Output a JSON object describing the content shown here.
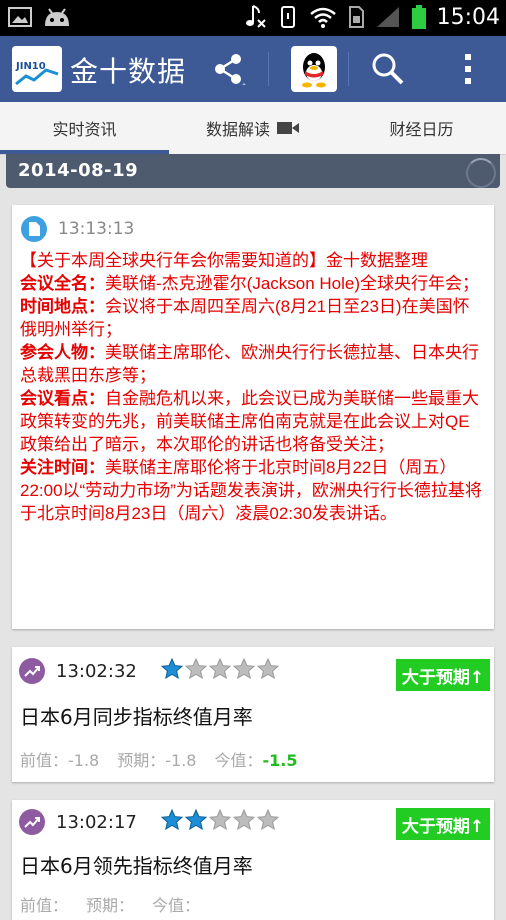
{
  "status_bar": {
    "time": "15:04",
    "icons": [
      "image-icon",
      "android-icon",
      "music-muted-icon",
      "vibrate-icon",
      "wifi-icon",
      "sim-icon",
      "signal-icon",
      "battery-icon"
    ]
  },
  "app": {
    "logo_text": "JIN10",
    "title": "金十数据",
    "actions": [
      "share-icon",
      "qq-icon",
      "search-icon",
      "overflow-menu-icon"
    ]
  },
  "tabs": [
    {
      "label": "实时资讯",
      "active": true
    },
    {
      "label": "数据解读",
      "icon": "video-camera-icon"
    },
    {
      "label": "财经日历"
    }
  ],
  "date_header": "2014-08-19",
  "news": {
    "time": "13:13:13",
    "headline": "【关于本周全球央行年会你需要知道的】金十数据整理",
    "sections": [
      {
        "label": "会议全名：",
        "text": "美联储-杰克逊霍尔(Jackson Hole)全球央行年会；"
      },
      {
        "label": "时间地点：",
        "text": "会议将于本周四至周六(8月21日至23日)在美国怀俄明州举行；"
      },
      {
        "label": "参会人物：",
        "text": "美联储主席耶伦、欧洲央行行长德拉基、日本央行总裁黑田东彦等；"
      },
      {
        "label": "会议看点：",
        "text": "自金融危机以来，此会议已成为美联储一些最重大政策转变的先兆，前美联储主席伯南克就是在此会议上对QE政策给出了暗示，本次耶伦的讲话也将备受关注；"
      },
      {
        "label": "关注时间：",
        "text": "美联储主席耶伦将于北京时间8月22日（周五）22:00以“劳动力市场”为话题发表演讲，欧洲央行行长德拉基将于北京时间8月23日（周六）凌晨02:30发表讲话。"
      }
    ]
  },
  "data_items": [
    {
      "time": "13:02:32",
      "stars": 1,
      "badge": "大于预期↑",
      "title": "日本6月同步指标终值月率",
      "previous_label": "前值：",
      "previous": "-1.8",
      "forecast_label": "预期：",
      "forecast": "-1.8",
      "actual_label": "今值：",
      "actual": "-1.5"
    },
    {
      "time": "13:02:17",
      "stars": 2,
      "badge": "大于预期↑",
      "title": "日本6月领先指标终值月率",
      "previous_label": "前值：",
      "previous": "",
      "forecast_label": "预期：",
      "forecast": "",
      "actual_label": "今值：",
      "actual": ""
    }
  ],
  "colors": {
    "action_bar": "#3d5a97",
    "news_text": "#e60000",
    "badge": "#22cc22",
    "star_filled": "#1e8fd6",
    "star_empty": "#bdbdbd"
  }
}
